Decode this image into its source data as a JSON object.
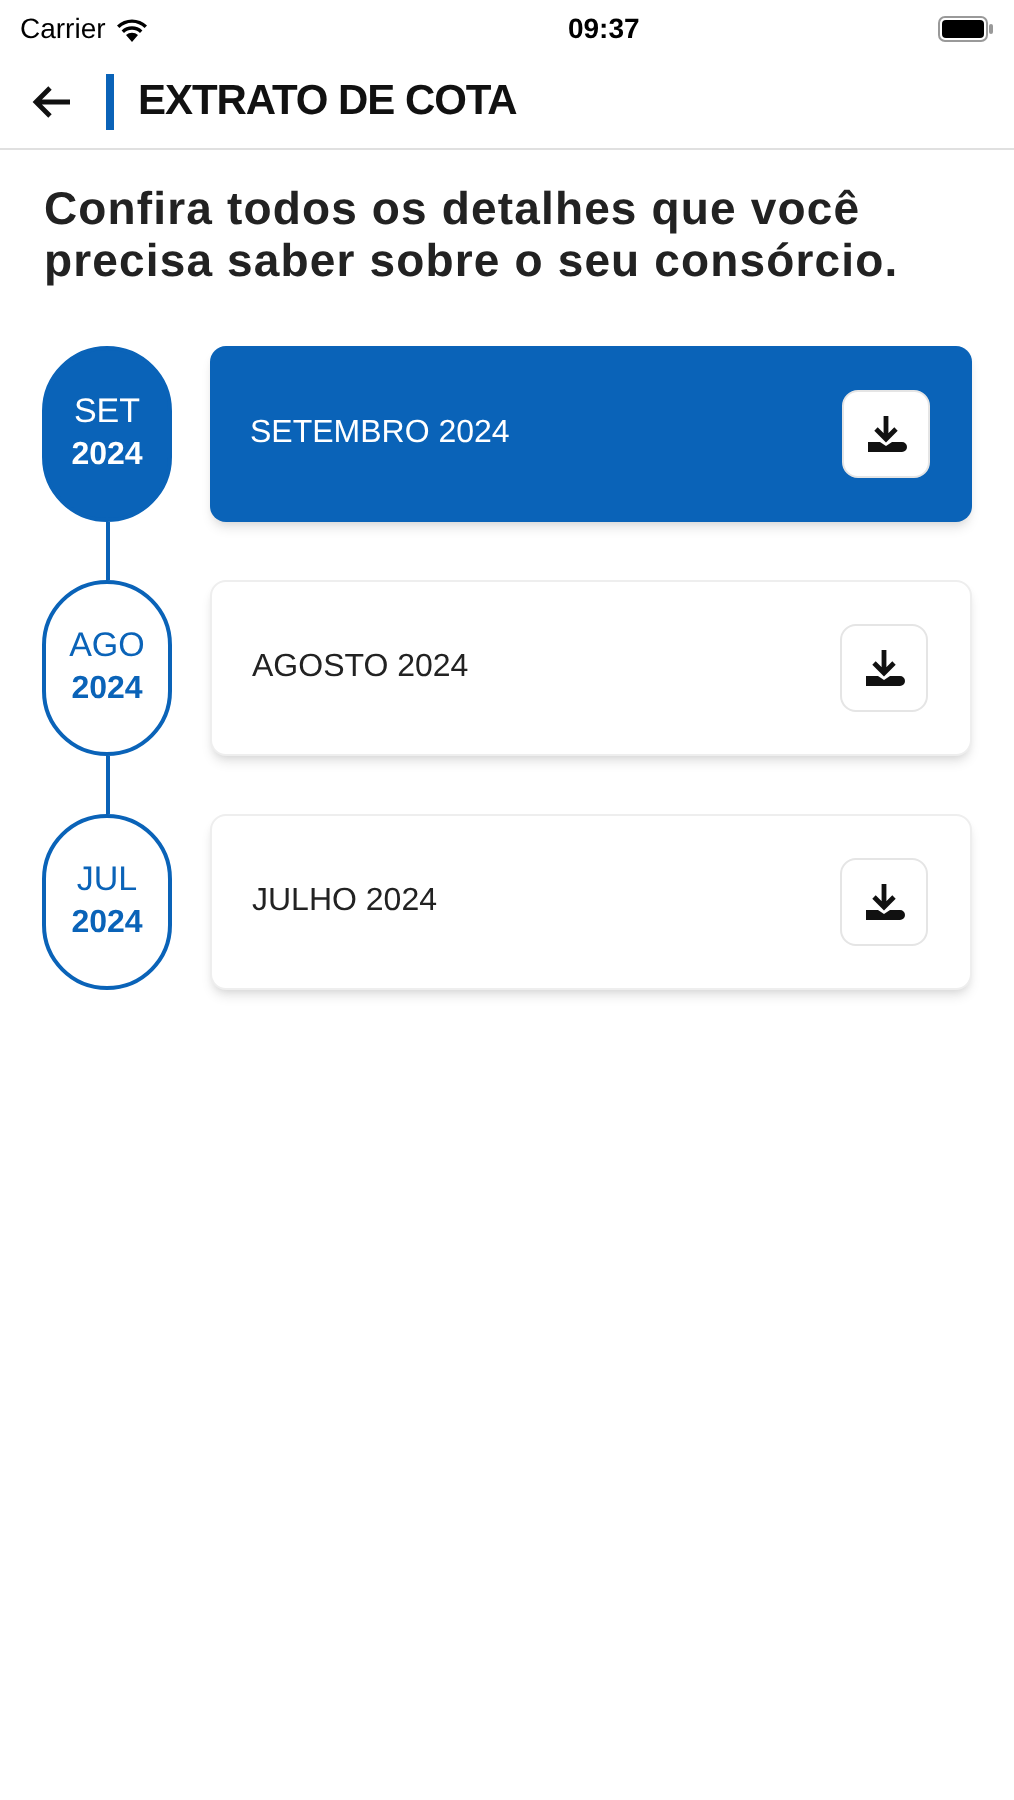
{
  "status_bar": {
    "carrier": "Carrier",
    "time": "09:37"
  },
  "header": {
    "title": "EXTRATO DE COTA"
  },
  "intro": "Confira todos os detalhes que você precisa saber sobre o seu consórcio.",
  "statements": [
    {
      "month": "SET",
      "year": "2024",
      "label": "SETEMBRO 2024",
      "selected": true
    },
    {
      "month": "AGO",
      "year": "2024",
      "label": "AGOSTO 2024",
      "selected": false
    },
    {
      "month": "JUL",
      "year": "2024",
      "label": "JULHO 2024",
      "selected": false
    }
  ]
}
